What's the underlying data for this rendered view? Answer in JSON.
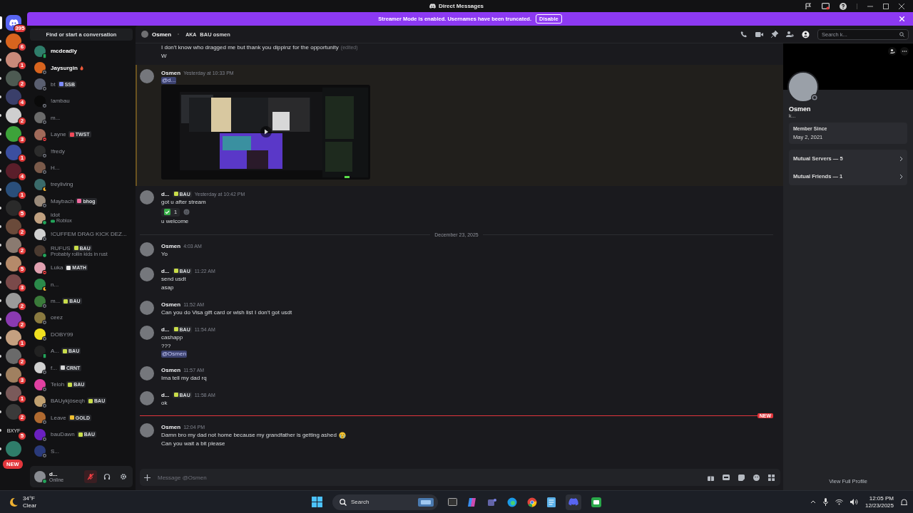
{
  "titlebar": {
    "title": "Direct Messages"
  },
  "banner": {
    "text": "Streamer Mode is enabled. Usernames have been truncated.",
    "button": "Disable"
  },
  "servers": [
    {
      "kind": "home",
      "badge": "395",
      "selected": true
    },
    {
      "kind": "avatar",
      "badge": "6",
      "selected": false
    },
    {
      "kind": "avatar",
      "badge": "1",
      "selected": false
    },
    {
      "kind": "avatar",
      "badge": "2",
      "selected": false
    },
    {
      "kind": "avatar",
      "badge": "4",
      "selected": false
    },
    {
      "kind": "avatar",
      "badge": "2",
      "selected": false
    },
    {
      "kind": "avatar",
      "badge": "3",
      "selected": false
    },
    {
      "kind": "avatar",
      "badge": "1",
      "selected": false
    },
    {
      "kind": "avatar",
      "badge": "4",
      "selected": false
    },
    {
      "kind": "avatar",
      "badge": "1",
      "selected": false
    },
    {
      "kind": "avatar",
      "badge": "5",
      "selected": false
    },
    {
      "kind": "avatar",
      "badge": "2",
      "selected": false
    },
    {
      "kind": "avatar",
      "badge": "2",
      "selected": false
    },
    {
      "kind": "avatar",
      "badge": "5",
      "selected": false
    },
    {
      "kind": "avatar",
      "badge": "3",
      "selected": false
    },
    {
      "kind": "avatar",
      "badge": "2",
      "selected": false
    },
    {
      "kind": "avatar",
      "badge": "2",
      "selected": false
    },
    {
      "kind": "avatar",
      "badge": "1",
      "selected": false
    },
    {
      "kind": "avatar",
      "badge": "2",
      "selected": false
    },
    {
      "kind": "avatar",
      "badge": "3",
      "selected": false
    },
    {
      "kind": "avatar",
      "badge": "1",
      "selected": false
    },
    {
      "kind": "avatar",
      "badge": "2",
      "selected": false
    },
    {
      "kind": "label",
      "label": "BXYF",
      "badge": "5",
      "selected": false
    },
    {
      "kind": "avatar",
      "selected": false
    }
  ],
  "new_pill": "NEW",
  "dm_search": {
    "placeholder": "Find or start a conversation"
  },
  "dms": [
    {
      "name": "mcdeadly",
      "unread": true,
      "kind": "mobile"
    },
    {
      "name": "Jaysurgin",
      "unread": true,
      "kind": "offline",
      "flame_icon": true
    },
    {
      "name": "bt",
      "unread": false,
      "kind": "offline",
      "tag": {
        "text": "SSB",
        "color": "#7d8cff"
      }
    },
    {
      "name": "!ambau",
      "unread": false,
      "kind": "offline"
    },
    {
      "name": "m...",
      "unread": false,
      "kind": "offline"
    },
    {
      "name": "Layne",
      "unread": false,
      "kind": "dnd",
      "tag": {
        "text": "TWST",
        "color": "#f04a5a"
      }
    },
    {
      "name": "!fredy",
      "unread": false,
      "kind": "offline"
    },
    {
      "name": "H...",
      "unread": false,
      "kind": "offline"
    },
    {
      "name": "treyliving",
      "unread": false,
      "kind": "idle"
    },
    {
      "name": "Maybach",
      "unread": false,
      "kind": "offline",
      "tag": {
        "text": "bhog",
        "color": "#f06aa0"
      }
    },
    {
      "name": "idot",
      "unread": false,
      "kind": "online",
      "subtitle": {
        "kind": "game",
        "text": "Roblox"
      }
    },
    {
      "name": "!CUFFEM DRAG KICK DEZ...",
      "unread": false,
      "kind": "offline"
    },
    {
      "name": "RUFUS",
      "unread": false,
      "kind": "online",
      "tag": {
        "text": "BAU",
        "color": "#c9dd4a"
      },
      "subtitle": {
        "kind": "custom",
        "text": "Probably rollin kids in rust"
      }
    },
    {
      "name": "Luka",
      "unread": false,
      "kind": "dnd",
      "tag": {
        "text": "MATH",
        "color": "#e8e8e8"
      }
    },
    {
      "name": "n...",
      "unread": false,
      "kind": "idle"
    },
    {
      "name": "m...",
      "unread": false,
      "kind": "offline",
      "tag": {
        "text": "BAU",
        "color": "#c9dd4a"
      }
    },
    {
      "name": "ceez",
      "unread": false,
      "kind": "offline"
    },
    {
      "name": "DOBY99",
      "unread": false,
      "kind": "offline"
    },
    {
      "name": "A...",
      "unread": false,
      "kind": "mobile",
      "tag": {
        "text": "BAU",
        "color": "#c9dd4a"
      }
    },
    {
      "name": "f...",
      "unread": false,
      "kind": "offline",
      "tag": {
        "text": "CRNT",
        "color": "#d8d8d8"
      }
    },
    {
      "name": "Teloh",
      "unread": false,
      "kind": "offline",
      "tag": {
        "text": "BAU",
        "color": "#c9dd4a"
      }
    },
    {
      "name": "BAUykjóseqh",
      "unread": false,
      "kind": "offline",
      "tag": {
        "text": "BAU",
        "color": "#c9dd4a"
      }
    },
    {
      "name": "Leave",
      "unread": false,
      "kind": "offline",
      "tag": {
        "text": "GOLD",
        "color": "#f0c030"
      }
    },
    {
      "name": "bauDawn",
      "unread": false,
      "kind": "offline",
      "tag": {
        "text": "BAU",
        "color": "#c9dd4a"
      }
    },
    {
      "name": "S...",
      "unread": false,
      "kind": "offline"
    }
  ],
  "user_panel": {
    "name": "d...",
    "status_text": "Online",
    "mic_muted": true
  },
  "chat_header": {
    "name": "Osmen",
    "aka_label": "AKA",
    "aka": "BAU osmen",
    "search_placeholder": "Search k..."
  },
  "messages": [
    {
      "kind": "group",
      "highlighted": false,
      "lines": [
        {
          "kind": "text",
          "text": "I don't know who dragged me but thank you dippinz for the opportunity",
          "suffix": "(edited)"
        },
        {
          "kind": "text",
          "text": "W"
        }
      ]
    },
    {
      "kind": "group",
      "author": "Osmen",
      "time": "Yesterday at 10:33 PM",
      "highlighted": true,
      "lines": [
        {
          "kind": "mention",
          "text": "@d..."
        },
        {
          "kind": "video"
        }
      ]
    },
    {
      "kind": "group",
      "author": "d...",
      "tag": {
        "text": "BAU",
        "color": "#c9dd4a"
      },
      "time": "Yesterday at 10:42 PM",
      "highlighted": false,
      "lines": [
        {
          "kind": "text",
          "text": "got u after stream"
        },
        {
          "kind": "reactions",
          "count": "1"
        },
        {
          "kind": "text",
          "text": "u welcome"
        }
      ]
    },
    {
      "kind": "date_divider",
      "text": "December 23, 2025"
    },
    {
      "kind": "group",
      "author": "Osmen",
      "time": "4:03 AM",
      "highlighted": false,
      "lines": [
        {
          "kind": "text",
          "text": "Yo"
        }
      ]
    },
    {
      "kind": "group",
      "author": "d...",
      "tag": {
        "text": "BAU",
        "color": "#c9dd4a"
      },
      "time": "11:22 AM",
      "highlighted": false,
      "lines": [
        {
          "kind": "text",
          "text": "send usdt"
        },
        {
          "kind": "text",
          "text": "asap"
        }
      ]
    },
    {
      "kind": "group",
      "author": "Osmen",
      "time": "11:52 AM",
      "highlighted": false,
      "lines": [
        {
          "kind": "text",
          "text": "Can you do Visa gift card or wish list I don't got usdt"
        }
      ]
    },
    {
      "kind": "group",
      "author": "d...",
      "tag": {
        "text": "BAU",
        "color": "#c9dd4a"
      },
      "time": "11:54 AM",
      "highlighted": false,
      "lines": [
        {
          "kind": "text",
          "text": "cashapp"
        },
        {
          "kind": "text",
          "text": "???"
        },
        {
          "kind": "mention",
          "text": "@Osmen"
        }
      ]
    },
    {
      "kind": "group",
      "author": "Osmen",
      "time": "11:57 AM",
      "highlighted": false,
      "lines": [
        {
          "kind": "text",
          "text": "Ima tell my dad rq"
        }
      ]
    },
    {
      "kind": "group",
      "author": "d...",
      "tag": {
        "text": "BAU",
        "color": "#c9dd4a"
      },
      "time": "11:58 AM",
      "highlighted": false,
      "lines": [
        {
          "kind": "text",
          "text": "ok"
        }
      ]
    },
    {
      "kind": "new_divider",
      "text": "NEW"
    },
    {
      "kind": "group",
      "author": "Osmen",
      "time": "12:04 PM",
      "highlighted": false,
      "lines": [
        {
          "kind": "text",
          "text": "Damn bro my dad not home because my grandfather is getting ashed",
          "crying_emoji": true
        },
        {
          "kind": "text",
          "text": "Can you wait a bit please"
        }
      ]
    }
  ],
  "composer": {
    "placeholder": "Message @Osmen"
  },
  "profile": {
    "name": "Osmen",
    "subtitle": "k...",
    "member_since_label": "Member Since",
    "member_since": "May 2, 2021",
    "links": [
      "Mutual Servers — 5",
      "Mutual Friends — 1"
    ],
    "footer": "View Full Profile"
  },
  "taskbar": {
    "temp": "34°F",
    "weather": "Clear",
    "search": "Search",
    "time": "12:05 PM",
    "date": "12/23/2025"
  }
}
